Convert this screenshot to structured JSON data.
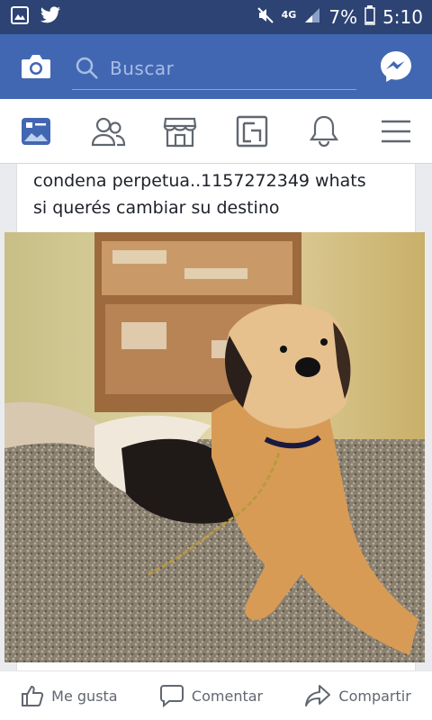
{
  "status_bar": {
    "network": "4G",
    "battery": "7%",
    "time": "5:10",
    "icons": [
      "gallery-icon",
      "twitter-icon",
      "mute-icon",
      "signal-icon",
      "battery-icon"
    ]
  },
  "search": {
    "placeholder": "Buscar"
  },
  "nav": {
    "items": [
      "news-feed-icon",
      "friends-icon",
      "marketplace-icon",
      "pages-icon",
      "notifications-icon",
      "menu-icon"
    ]
  },
  "post": {
    "line1": "condena perpetua..1157272349 whats",
    "line2": "si querés cambiar su destino",
    "photo_subject": "dog"
  },
  "actions": {
    "like": "Me gusta",
    "comment": "Comentar",
    "share": "Compartir"
  },
  "colors": {
    "brand": "#4267b2",
    "status": "#2d4373",
    "active": "#4267b2"
  }
}
